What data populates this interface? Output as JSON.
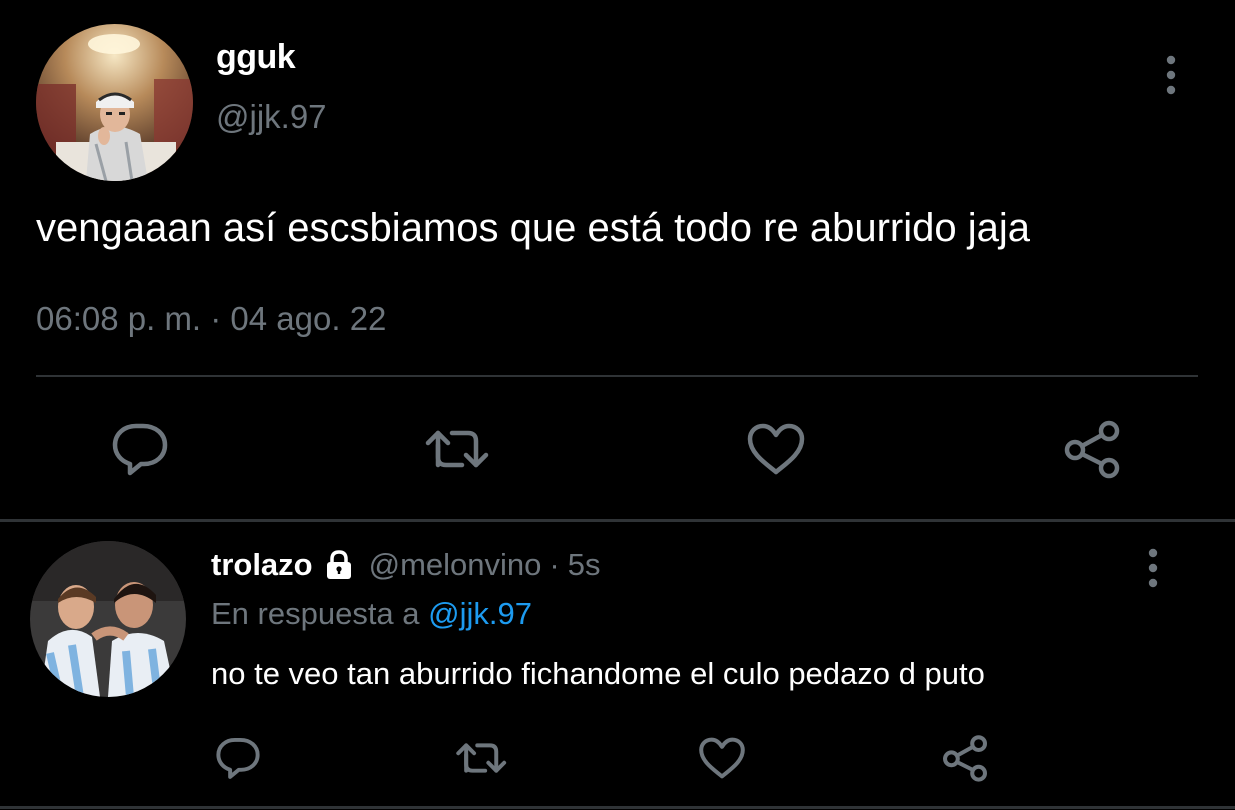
{
  "colors": {
    "background": "#000000",
    "text_primary": "#ffffff",
    "text_secondary": "#6e767d",
    "link": "#1d9bf0",
    "divider": "#2f3336"
  },
  "main_tweet": {
    "display_name": "gguk",
    "handle": "@jjk.97",
    "text": "vengaaan así escsbiamos que está todo re aburrido jaja",
    "timestamp": "06:08 p. m. · 04 ago. 22",
    "actions": {
      "reply_icon": "reply-icon",
      "retweet_icon": "retweet-icon",
      "like_icon": "heart-icon",
      "share_icon": "share-icon"
    }
  },
  "reply": {
    "display_name": "trolazo",
    "protected_icon": "lock-icon",
    "handle": "@melonvino",
    "separator": "·",
    "time": "5s",
    "in_reply_to_prefix": "En respuesta a",
    "in_reply_to_handle": "@jjk.97",
    "text": "no te veo tan aburrido fichandome el culo pedazo d puto",
    "actions": {
      "reply_icon": "reply-icon",
      "retweet_icon": "retweet-icon",
      "like_icon": "heart-icon",
      "share_icon": "share-icon"
    }
  }
}
